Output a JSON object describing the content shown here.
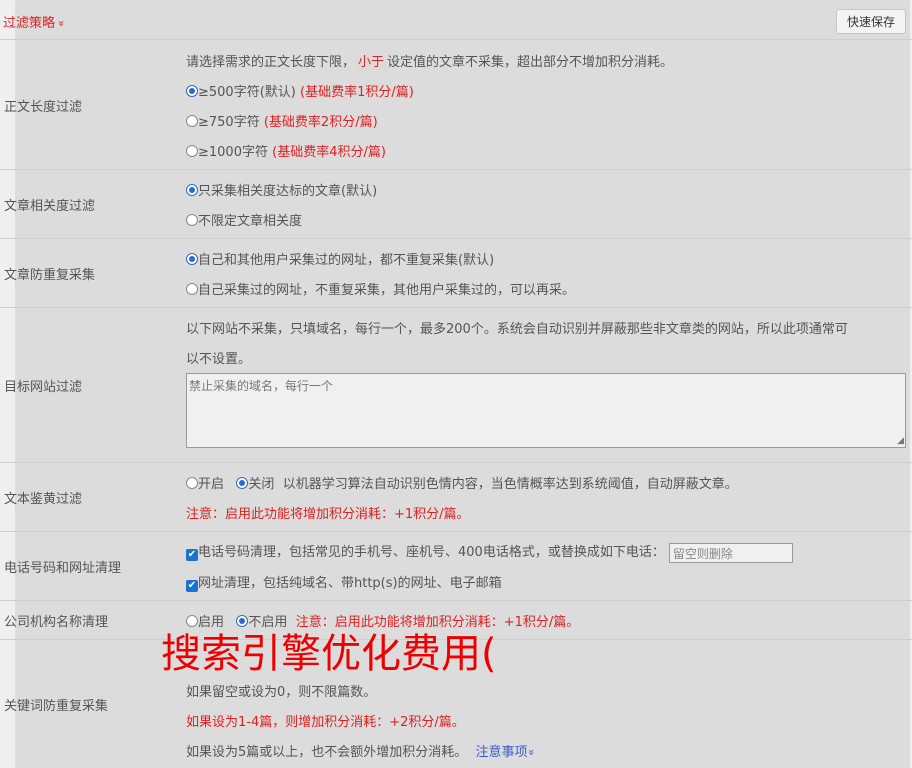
{
  "header": {
    "title": "过滤策略",
    "chevron": "»",
    "save_label": "快速保存"
  },
  "text_length": {
    "label": "正文长度过滤",
    "desc_pre": "请选择需求的正文长度下限，",
    "desc_hl": "小于",
    "desc_post": "设定值的文章不采集，超出部分不增加积分消耗。",
    "options": [
      {
        "text": "≥500字符(默认)",
        "note": "(基础费率1积分/篇)",
        "checked": true
      },
      {
        "text": "≥750字符",
        "note": "(基础费率2积分/篇)",
        "checked": false
      },
      {
        "text": "≥1000字符",
        "note": "(基础费率4积分/篇)",
        "checked": false
      }
    ]
  },
  "relevance": {
    "label": "文章相关度过滤",
    "options": [
      {
        "text": "只采集相关度达标的文章(默认)",
        "checked": true
      },
      {
        "text": "不限定文章相关度",
        "checked": false
      }
    ]
  },
  "dedupe": {
    "label": "文章防重复采集",
    "options": [
      {
        "text": "自己和其他用户采集过的网址，都不重复采集(默认)",
        "checked": true
      },
      {
        "text": "自己采集过的网址，不重复采集，其他用户采集过的，可以再采。",
        "checked": false
      }
    ]
  },
  "target_site": {
    "label": "目标网站过滤",
    "desc_line1": "以下网站不采集，只填域名，每行一个，最多200个。系统会自动识别并屏蔽那些非文章类的网站，所以此项通常可",
    "desc_line2": "以不设置。",
    "placeholder": "禁止采集的域名，每行一个"
  },
  "porn": {
    "label": "文本鉴黄过滤",
    "on_label": "开启",
    "off_label": "关闭",
    "desc": "以机器学习算法自动识别色情内容，当色情概率达到系统阈值，自动屏蔽文章。",
    "note": "注意：启用此功能将增加积分消耗：+1积分/篇。"
  },
  "phone": {
    "label": "电话号码和网址清理",
    "phone_text": "电话号码清理，包括常见的手机号、座机号、400电话格式，或替换成如下电话：",
    "phone_placeholder": "留空则删除",
    "url_text": "网址清理，包括纯域名、带http(s)的网址、电子邮箱"
  },
  "company": {
    "label": "公司机构名称清理",
    "on_label": "启用",
    "off_label": "不启用",
    "note": "注意：启用此功能将增加积分消耗：+1积分/篇。"
  },
  "keyword": {
    "label": "关键词防重复采集",
    "line1": "如果留空或设为0，则不限篇数。",
    "line2": "如果设为1-4篇，则增加积分消耗：+2积分/篇。",
    "line3": "如果设为5篇或以上，也不会额外增加积分消耗。",
    "link": "注意事项",
    "link_chevron": "»"
  },
  "watermark": "搜索引擎优化费用("
}
